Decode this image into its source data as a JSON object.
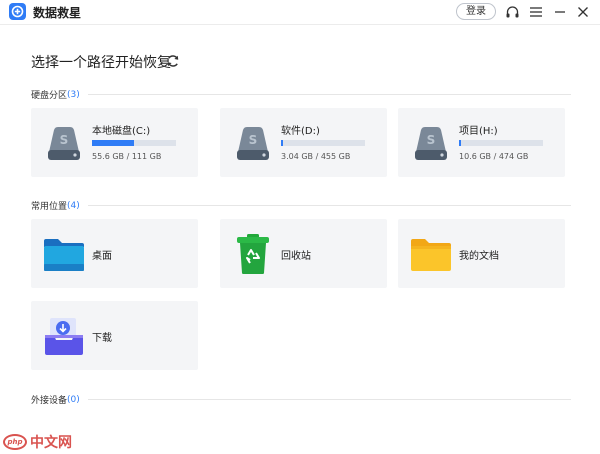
{
  "app": {
    "title": "数据救星"
  },
  "titlebar": {
    "login_label": "登录"
  },
  "page": {
    "heading": "选择一个路径开始恢复"
  },
  "sections": {
    "partitions": {
      "label": "硬盘分区",
      "count": "(3)"
    },
    "common": {
      "label": "常用位置",
      "count": "(4)"
    },
    "external": {
      "label": "外接设备",
      "count": "(0)"
    }
  },
  "drives": [
    {
      "name": "本地磁盘(C:)",
      "size": "55.6 GB / 111 GB",
      "used_fraction": 0.5
    },
    {
      "name": "软件(D:)",
      "size": "3.04 GB / 455 GB",
      "used_fraction": 0.01
    },
    {
      "name": "项目(H:)",
      "size": "10.6 GB / 474 GB",
      "used_fraction": 0.02
    }
  ],
  "locations": [
    {
      "name": "桌面",
      "icon": "desktop-folder-icon"
    },
    {
      "name": "回收站",
      "icon": "recycle-bin-icon"
    },
    {
      "name": "我的文档",
      "icon": "documents-folder-icon"
    },
    {
      "name": "下载",
      "icon": "download-tray-icon"
    }
  ],
  "brand": {
    "logo": "php",
    "text": "中文网"
  },
  "colors": {
    "accent": "#2f7cf6",
    "card_bg": "#f4f5f7",
    "brand": "#d9534f"
  }
}
